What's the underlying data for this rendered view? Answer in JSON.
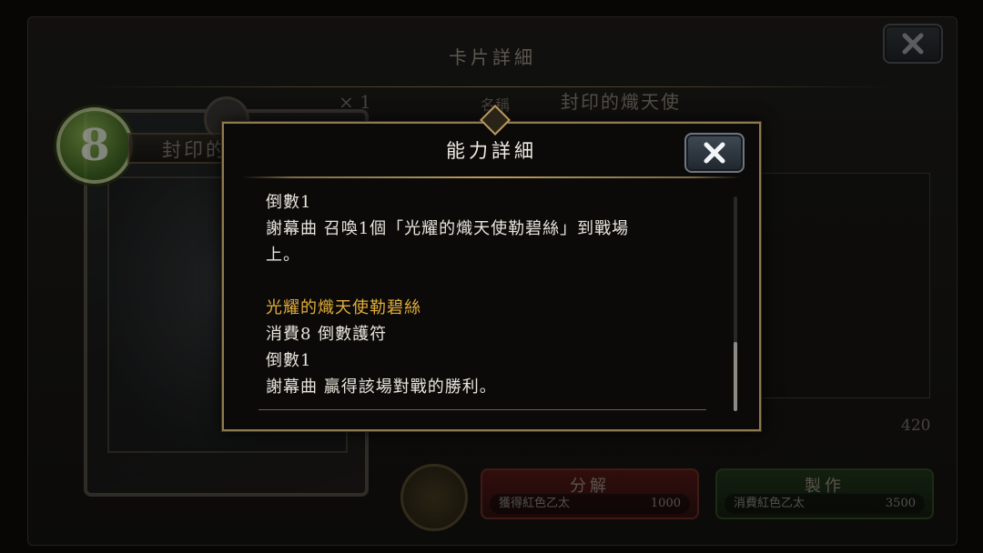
{
  "background": {
    "title": "卡片詳細",
    "card": {
      "cost": "8",
      "name": "封印的熾天使",
      "count": "× 1"
    },
    "info": {
      "name_label": "名稱",
      "name_value": "封印的熾天使",
      "qty": "420"
    },
    "buttons": {
      "dissolve": {
        "label": "分解",
        "sub_label": "獲得紅色乙太",
        "sub_value": "1000"
      },
      "craft": {
        "label": "製作",
        "sub_label": "消費紅色乙太",
        "sub_value": "3500"
      }
    }
  },
  "dialog": {
    "title": "能力詳細",
    "lines": {
      "l1": "倒數1",
      "l2": "謝幕曲 召喚1個「光耀的熾天使勒碧絲」到戰場",
      "l3": "上。",
      "l4": "光耀的熾天使勒碧絲",
      "l5": "消費8 倒數護符",
      "l6": "倒數1",
      "l7": "謝幕曲 贏得該場對戰的勝利。"
    },
    "scroll_position": 0.68
  },
  "colors": {
    "highlight": "#e2ae3a",
    "frame_gold": "#8e7a4f",
    "text": "#e9e5dc"
  },
  "icons": [
    "close-icon",
    "star-icon",
    "shield-icon"
  ]
}
